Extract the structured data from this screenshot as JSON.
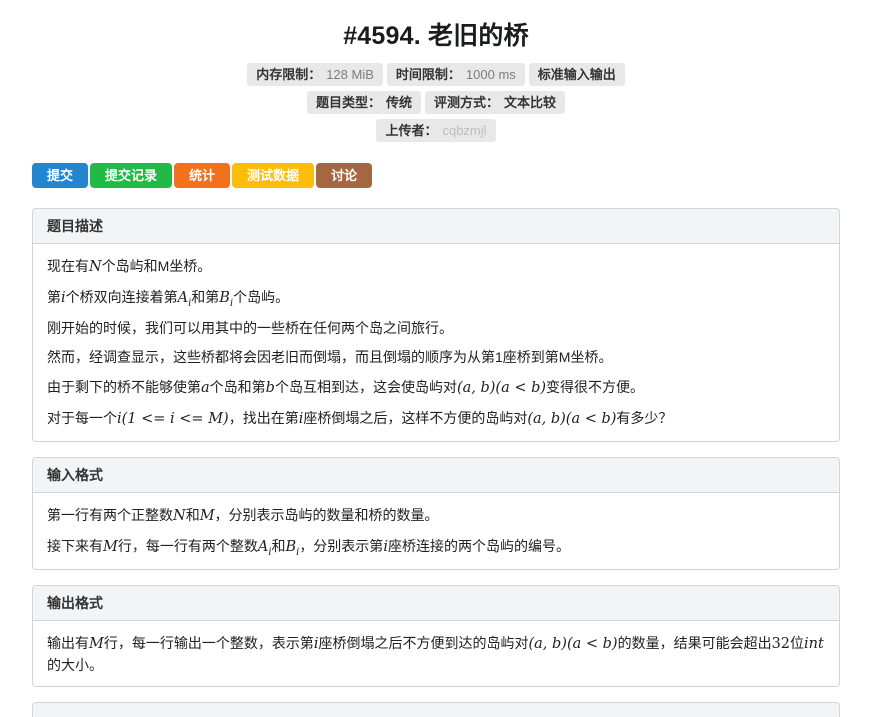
{
  "header": {
    "title": "#4594. 老旧的桥"
  },
  "colors": {
    "badge_bg": "#e8e8e8",
    "panel_border": "#d4d4d5",
    "panel_header_bg": "#f3f4f5",
    "button_blue": "#2185d0",
    "button_green": "#21ba45",
    "button_orange": "#f2711c",
    "button_yellow": "#fbbd08",
    "button_brown": "#a5673f"
  },
  "badges": {
    "rows": [
      [
        {
          "name": "memory-limit-badge",
          "label": "内存限制：",
          "value": "128 MiB",
          "value_style": "muted"
        },
        {
          "name": "time-limit-badge",
          "label": "时间限制：",
          "value": "1000 ms",
          "value_style": "muted"
        },
        {
          "name": "io-mode-badge",
          "label": "标准输入输出"
        }
      ],
      [
        {
          "name": "problem-type-badge",
          "label": "题目类型：",
          "value": "传统"
        },
        {
          "name": "judge-mode-badge",
          "label": "评测方式：",
          "value": "文本比较"
        }
      ],
      [
        {
          "name": "uploader-badge",
          "label": "上传者：",
          "value": "cqbzmjl",
          "value_style": "link",
          "value_interactable": true
        }
      ]
    ]
  },
  "buttons": [
    {
      "name": "submit-button",
      "label": "提交",
      "color": "#2185d0"
    },
    {
      "name": "submissions-button",
      "label": "提交记录",
      "color": "#21ba45"
    },
    {
      "name": "statistics-button",
      "label": "统计",
      "color": "#f2711c"
    },
    {
      "name": "testdata-button",
      "label": "测试数据",
      "color": "#fbbd08"
    },
    {
      "name": "discussion-button",
      "label": "讨论",
      "color": "#a5673f"
    }
  ],
  "sections": [
    {
      "name": "section-description",
      "heading": "题目描述",
      "paragraphs": [
        [
          {
            "t": "text",
            "v": "现在有"
          },
          {
            "t": "math",
            "v": "N"
          },
          {
            "t": "text",
            "v": "个岛屿和M坐桥。"
          }
        ],
        [
          {
            "t": "text",
            "v": "第"
          },
          {
            "t": "math",
            "v": "i"
          },
          {
            "t": "text",
            "v": "个桥双向连接着第"
          },
          {
            "t": "msub",
            "v": "A",
            "s": "i"
          },
          {
            "t": "text",
            "v": "和第"
          },
          {
            "t": "msub",
            "v": "B",
            "s": "i"
          },
          {
            "t": "text",
            "v": "个岛屿。"
          }
        ],
        [
          {
            "t": "text",
            "v": "刚开始的时候，我们可以用其中的一些桥在任何两个岛之间旅行。"
          }
        ],
        [
          {
            "t": "text",
            "v": "然而，经调查显示，这些桥都将会因老旧而倒塌，而且倒塌的顺序为从第1座桥到第M坐桥。"
          }
        ],
        [
          {
            "t": "text",
            "v": "由于剩下的桥不能够使第"
          },
          {
            "t": "math",
            "v": "a"
          },
          {
            "t": "text",
            "v": "个岛和第"
          },
          {
            "t": "math",
            "v": "b"
          },
          {
            "t": "text",
            "v": "个岛互相到达，这会使岛屿对"
          },
          {
            "t": "math",
            "v": "(a, b)(a < b)"
          },
          {
            "t": "text",
            "v": "变得很不方便。"
          }
        ],
        [
          {
            "t": "text",
            "v": "对于每一个"
          },
          {
            "t": "math",
            "v": "i(1 <= i <= M)"
          },
          {
            "t": "text",
            "v": "，找出在第"
          },
          {
            "t": "math",
            "v": "i"
          },
          {
            "t": "text",
            "v": "座桥倒塌之后，这样不方便的岛屿对"
          },
          {
            "t": "math",
            "v": "(a, b)(a < b)"
          },
          {
            "t": "text",
            "v": "有多少？"
          }
        ]
      ]
    },
    {
      "name": "section-input-format",
      "heading": "输入格式",
      "paragraphs": [
        [
          {
            "t": "text",
            "v": "第一行有两个正整数"
          },
          {
            "t": "math",
            "v": "N"
          },
          {
            "t": "text",
            "v": "和"
          },
          {
            "t": "math",
            "v": "M"
          },
          {
            "t": "text",
            "v": "，分别表示岛屿的数量和桥的数量。"
          }
        ],
        [
          {
            "t": "text",
            "v": "接下来有"
          },
          {
            "t": "math",
            "v": "M"
          },
          {
            "t": "text",
            "v": "行，每一行有两个整数"
          },
          {
            "t": "msub",
            "v": "A",
            "s": "i"
          },
          {
            "t": "text",
            "v": "和"
          },
          {
            "t": "msub",
            "v": "B",
            "s": "i"
          },
          {
            "t": "text",
            "v": "，分别表示第"
          },
          {
            "t": "math",
            "v": "i"
          },
          {
            "t": "text",
            "v": "座桥连接的两个岛屿的编号。"
          }
        ]
      ]
    },
    {
      "name": "section-output-format",
      "heading": "输出格式",
      "paragraphs": [
        [
          {
            "t": "text",
            "v": "输出有"
          },
          {
            "t": "math",
            "v": "M"
          },
          {
            "t": "text",
            "v": "行，每一行输出一个整数，表示第"
          },
          {
            "t": "math",
            "v": "i"
          },
          {
            "t": "text",
            "v": "座桥倒塌之后不方便到达的岛屿对"
          },
          {
            "t": "math",
            "v": "(a, b)(a < b)"
          },
          {
            "t": "text",
            "v": "的数量，结果可能会超出"
          },
          {
            "t": "mnum",
            "v": "32"
          },
          {
            "t": "text",
            "v": "位"
          },
          {
            "t": "math",
            "v": "int"
          },
          {
            "t": "text",
            "v": "的大小。"
          }
        ]
      ]
    }
  ]
}
